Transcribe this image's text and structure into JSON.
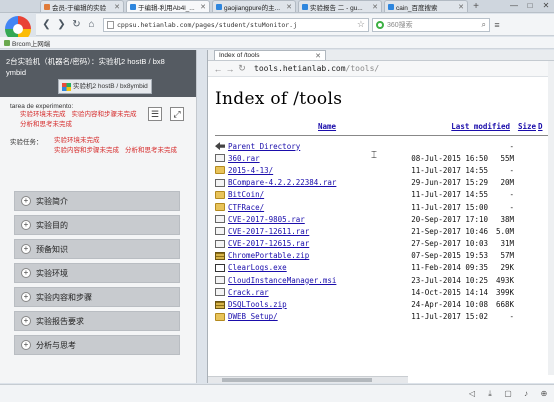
{
  "browser": {
    "tabs": [
      {
        "label": "会员-于编辑的实验",
        "color": "#e07b39",
        "active": false
      },
      {
        "label": "于编辑-利用Ab4l_...",
        "color": "#2e86de",
        "active": true
      },
      {
        "label": "gaojiangpure的主...",
        "color": "#2e86de",
        "active": false
      },
      {
        "label": "实验报告 二 - gu...",
        "color": "#2e86de",
        "active": false
      },
      {
        "label": "cain_百度搜索",
        "color": "#2e86de",
        "active": false
      }
    ],
    "new_tab": "+",
    "window_controls": [
      "—",
      "□",
      "✕"
    ],
    "address": "cppsu.hetianlab.com/pages/student/stuMonitor.j",
    "search_placeholder": "360搜索",
    "bookmark": "Brcom上网端"
  },
  "left_panel": {
    "header_line1": "2台实验机（机器名/密码）：实验机2  hostB / bx8",
    "header_line2": "ymbid",
    "vm_tab_label": "实验机2  hostB / bx8ymbid",
    "exp_label": "tarea de experimento:",
    "exp_links": [
      "实验环境未完成",
      "实验内容和步骤未完成",
      "分析和思考未完成"
    ],
    "task_label": "实验任务：",
    "task_links": [
      "实验环境未完成",
      "实验内容和步骤未完成",
      "分析和思考未完成"
    ],
    "menu": [
      {
        "label": "实验简介"
      },
      {
        "label": "实验目的"
      },
      {
        "label": "预备知识"
      },
      {
        "label": "实验环境"
      },
      {
        "label": "实验内容和步骤"
      },
      {
        "label": "实验报告要求"
      },
      {
        "label": "分析与思考"
      }
    ]
  },
  "vm_browser": {
    "tab_label": "Index of /tools",
    "url_host": "tools.hetianlab.com",
    "url_path": "/tools/",
    "heading": "Index of /tools",
    "col_name": "Name",
    "col_modified": "Last modified",
    "col_size": "Size",
    "col_desc": "D",
    "entries": [
      {
        "name": "Parent Directory",
        "date": "",
        "size": "-",
        "icon": "back"
      },
      {
        "name": "360.rar",
        "date": "08-Jul-2015 16:50",
        "size": "55M",
        "icon": "file"
      },
      {
        "name": "2015-4-13/",
        "date": "11-Jul-2017 14:55",
        "size": "-",
        "icon": "folder"
      },
      {
        "name": "BCompare-4.2.2.22384.rar",
        "date": "29-Jun-2017 15:29",
        "size": "20M",
        "icon": "file"
      },
      {
        "name": "BitCoin/",
        "date": "11-Jul-2017 14:55",
        "size": "-",
        "icon": "folder"
      },
      {
        "name": "CTFRace/",
        "date": "11-Jul-2017 15:00",
        "size": "-",
        "icon": "folder"
      },
      {
        "name": "CVE-2017-9805.rar",
        "date": "20-Sep-2017 17:10",
        "size": "38M",
        "icon": "file"
      },
      {
        "name": "CVE-2017-12611.rar",
        "date": "21-Sep-2017 10:46",
        "size": "5.0M",
        "icon": "file"
      },
      {
        "name": "CVE-2017-12615.rar",
        "date": "27-Sep-2017 10:03",
        "size": "31M",
        "icon": "file"
      },
      {
        "name": "ChromePortable.zip",
        "date": "07-Sep-2015 19:53",
        "size": "57M",
        "icon": "zip"
      },
      {
        "name": "ClearLogs.exe",
        "date": "11-Feb-2014 09:35",
        "size": "29K",
        "icon": "exe"
      },
      {
        "name": "CloudInstanceManager.msi",
        "date": "23-Jul-2014 10:25",
        "size": "493K",
        "icon": "file"
      },
      {
        "name": "Crack.rar",
        "date": "14-Oct-2015 14:14",
        "size": "399K",
        "icon": "file"
      },
      {
        "name": "DSQLTools.zip",
        "date": "24-Apr-2014 10:08",
        "size": "668K",
        "icon": "zip"
      },
      {
        "name": "DWEB_Setup/",
        "date": "11-Jul-2017 15:02",
        "size": "-",
        "icon": "folder"
      }
    ]
  },
  "status_icons": [
    "speaker-icon",
    "download-icon",
    "fullscreen-icon",
    "sound-icon",
    "zoom-icon"
  ]
}
